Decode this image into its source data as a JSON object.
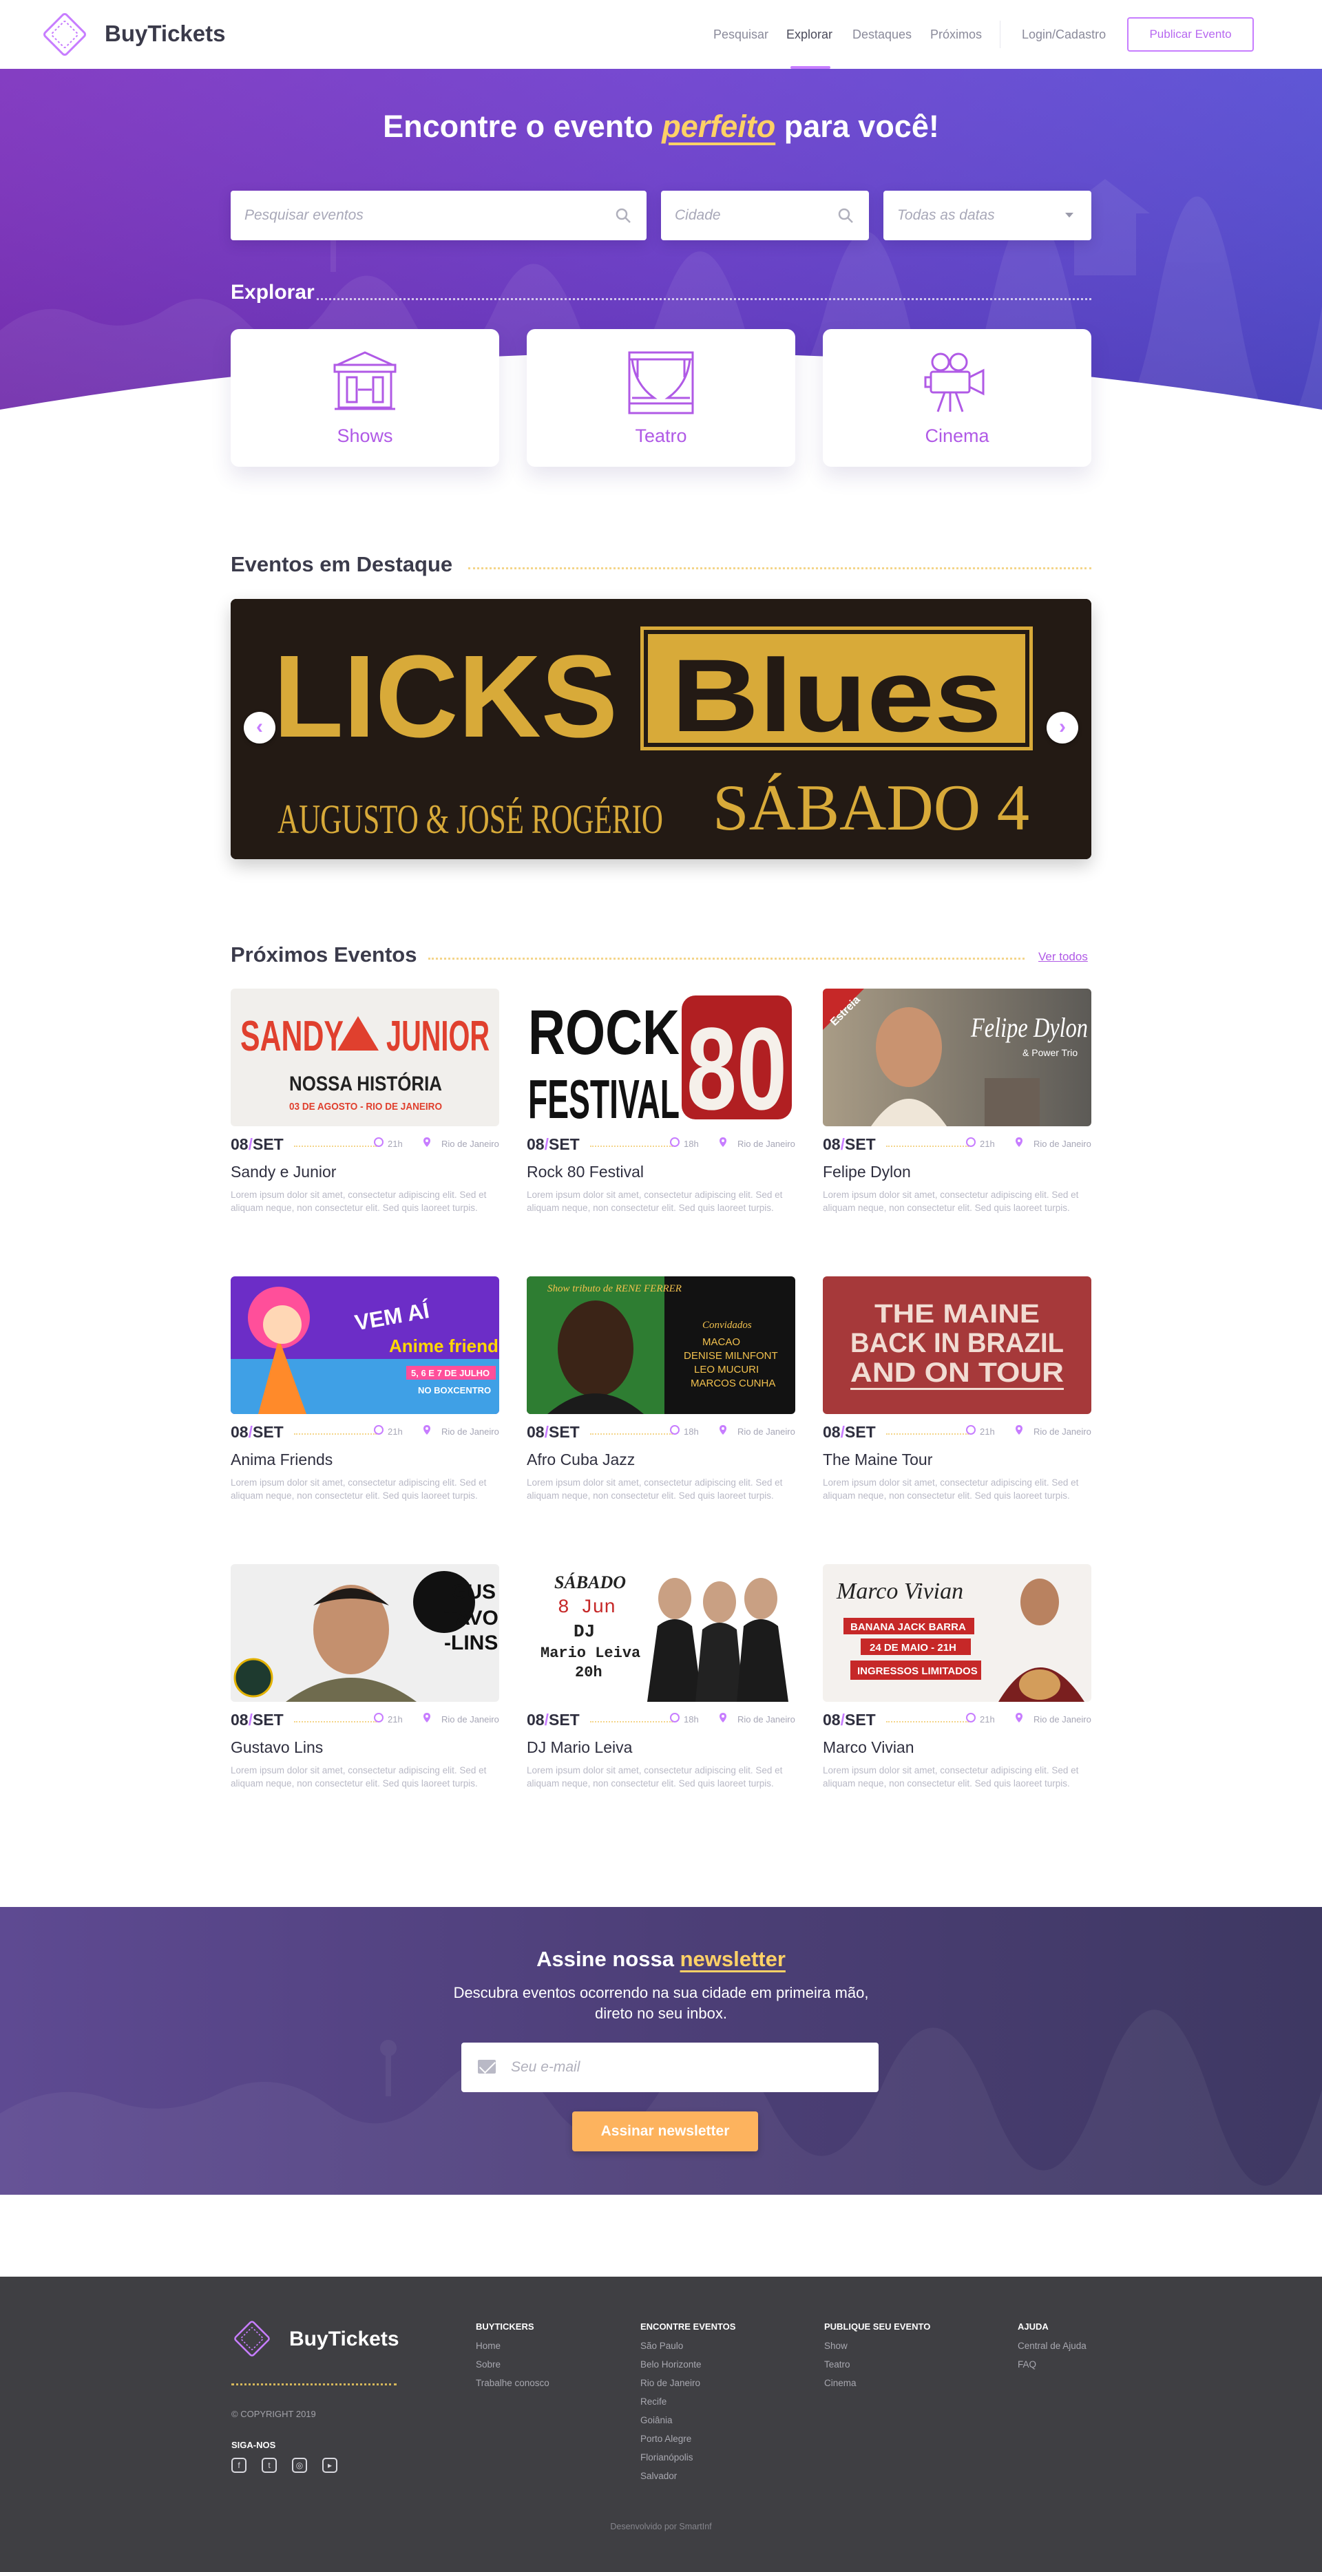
{
  "nav": {
    "brand": "BuyTickets",
    "links": [
      "Pesquisar",
      "Explorar",
      "Destaques",
      "Próximos"
    ],
    "login": "Login/Cadastro",
    "publish": "Publicar Evento"
  },
  "hero": {
    "title_before": "Encontre o evento ",
    "title_highlight": "perfeito",
    "title_after": " para você!",
    "search_placeholder": "Pesquisar eventos",
    "city_placeholder": "Cidade",
    "date_selected": "Todas as datas"
  },
  "explore": {
    "title": "Explorar",
    "categories": [
      {
        "label": "Shows",
        "icon": "stage-icon"
      },
      {
        "label": "Teatro",
        "icon": "theater-curtain-icon"
      },
      {
        "label": "Cinema",
        "icon": "movie-camera-icon"
      }
    ]
  },
  "featured": {
    "title": "Eventos em Destaque",
    "banner": {
      "word1": "LICKS",
      "word2": "Blues",
      "artists": "AUGUSTO & JOSÉ ROGÉRIO",
      "day": "SÁBADO 4"
    },
    "prev": "‹",
    "next": "›"
  },
  "upcoming": {
    "title": "Próximos Eventos",
    "see_all": "Ver todos",
    "events": [
      {
        "day": "08",
        "month": "SET",
        "time": "21h",
        "city": "Rio de Janeiro",
        "name": "Sandy e Junior",
        "desc": "Lorem ipsum dolor sit amet, consectetur adipiscing elit. Sed et aliquam neque, non consectetur elit. Sed quis laoreet turpis.",
        "poster": {
          "line1": "SANDY",
          "line2": "JUNIOR",
          "line3": "NOSSA HISTÓRIA",
          "line4": "03 DE AGOSTO - RIO DE JANEIRO"
        }
      },
      {
        "day": "08",
        "month": "SET",
        "time": "18h",
        "city": "Rio de Janeiro",
        "name": "Rock 80 Festival",
        "desc": "Lorem ipsum dolor sit amet, consectetur adipiscing elit. Sed et aliquam neque, non consectetur elit. Sed quis laoreet turpis.",
        "poster": {
          "line1": "ROCK",
          "line2": "80",
          "line3": "FESTIVAL"
        }
      },
      {
        "day": "08",
        "month": "SET",
        "time": "21h",
        "city": "Rio de Janeiro",
        "name": "Felipe Dylon",
        "desc": "Lorem ipsum dolor sit amet, consectetur adipiscing elit. Sed et aliquam neque, non consectetur elit. Sed quis laoreet turpis.",
        "poster": {
          "line1": "Felipe Dylon",
          "line2": "& Power Trio",
          "line3": "Estreia"
        }
      },
      {
        "day": "08",
        "month": "SET",
        "time": "21h",
        "city": "Rio de Janeiro",
        "name": "Anima Friends",
        "desc": "Lorem ipsum dolor sit amet, consectetur adipiscing elit. Sed et aliquam neque, non consectetur elit. Sed quis laoreet turpis.",
        "poster": {
          "line1": "VEM AÍ",
          "line2": "Anime friends",
          "line3": "5, 6 E 7 DE JULHO",
          "line4": "NO BOXCENTRO"
        }
      },
      {
        "day": "08",
        "month": "SET",
        "time": "18h",
        "city": "Rio de Janeiro",
        "name": "Afro Cuba Jazz",
        "desc": "Lorem ipsum dolor sit amet, consectetur adipiscing elit. Sed et aliquam neque, non consectetur elit. Sed quis laoreet turpis.",
        "poster": {
          "line1": "Show tributo de RENE FERRER",
          "line2": "Convidados",
          "line3": "MACAO",
          "line4": "DENISE MILNFONT",
          "line5": "LEO MUCURI",
          "line6": "MARCOS CUNHA"
        }
      },
      {
        "day": "08",
        "month": "SET",
        "time": "21h",
        "city": "Rio de Janeiro",
        "name": "The Maine Tour",
        "desc": "Lorem ipsum dolor sit amet, consectetur adipiscing elit. Sed et aliquam neque, non consectetur elit. Sed quis laoreet turpis.",
        "poster": {
          "line1": "THE MAINE",
          "line2": "BACK IN BRAZIL",
          "line3": "AND ON TOUR"
        }
      },
      {
        "day": "08",
        "month": "SET",
        "time": "21h",
        "city": "Rio de Janeiro",
        "name": "Gustavo Lins",
        "desc": "Lorem ipsum dolor sit amet, consectetur adipiscing elit. Sed et aliquam neque, non consectetur elit. Sed quis laoreet turpis.",
        "poster": {
          "line1": "GUS",
          "line2": "TAVO",
          "line3": "-LINS"
        }
      },
      {
        "day": "08",
        "month": "SET",
        "time": "18h",
        "city": "Rio de Janeiro",
        "name": "DJ Mario Leiva",
        "desc": "Lorem ipsum dolor sit amet, consectetur adipiscing elit. Sed et aliquam neque, non consectetur elit. Sed quis laoreet turpis.",
        "poster": {
          "line1": "SÁBADO",
          "line2": "8 Jun",
          "line3": "DJ",
          "line4": "Mario Leiva",
          "line5": "20h"
        }
      },
      {
        "day": "08",
        "month": "SET",
        "time": "21h",
        "city": "Rio de Janeiro",
        "name": "Marco Vivian",
        "desc": "Lorem ipsum dolor sit amet, consectetur adipiscing elit. Sed et aliquam neque, non consectetur elit. Sed quis laoreet turpis.",
        "poster": {
          "line1": "Marco Vivian",
          "line2": "BANANA JACK BARRA",
          "line3": "24 DE MAIO - 21H",
          "line4": "INGRESSOS LIMITADOS"
        }
      }
    ]
  },
  "newsletter": {
    "title_before": "Assine nossa ",
    "title_highlight": "newsletter",
    "subtitle_line1": "Descubra eventos ocorrendo na sua cidade em primeira mão,",
    "subtitle_line2": "direto no seu inbox.",
    "email_placeholder": "Seu e-mail",
    "button": "Assinar newsletter"
  },
  "footer": {
    "brand": "BuyTickets",
    "copyright": "© COPYRIGHT 2019",
    "follow": "SIGA-NOS",
    "social": [
      "facebook-icon",
      "twitter-icon",
      "instagram-icon",
      "youtube-icon"
    ],
    "columns": [
      {
        "title": "BUYTICKERS",
        "items": [
          "Home",
          "Sobre",
          "Trabalhe conosco"
        ]
      },
      {
        "title": "ENCONTRE EVENTOS",
        "items": [
          "São Paulo",
          "Belo Horizonte",
          "Rio de Janeiro",
          "Recife",
          "Goiânia",
          "Porto Alegre",
          "Florianópolis",
          "Salvador"
        ]
      },
      {
        "title": "PUBLIQUE SEU EVENTO",
        "items": [
          "Show",
          "Teatro",
          "Cinema"
        ]
      },
      {
        "title": "AJUDA",
        "items": [
          "Central de Ajuda",
          "FAQ"
        ]
      }
    ],
    "credit": "Desenvolvido por SmartInf"
  },
  "colors": {
    "brand_purple": "#c77dff",
    "hero_start": "#7b2fbf",
    "hero_end": "#4f44cc",
    "accent_yellow": "#ffd166",
    "cta_orange": "#fdb35e",
    "footer_bg": "#3f3f43"
  }
}
